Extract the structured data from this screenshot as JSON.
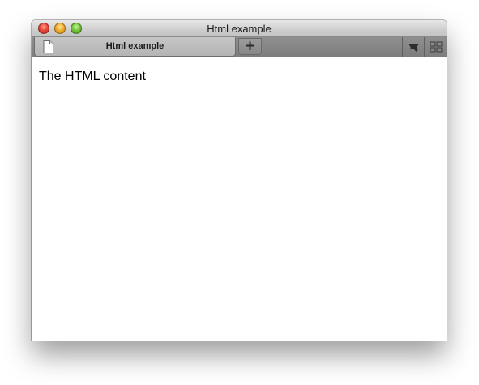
{
  "window": {
    "title": "Html example"
  },
  "tabs": [
    {
      "label": "Html example",
      "active": true
    }
  ],
  "new_tab_label": "+",
  "content": {
    "text": "The HTML content"
  }
}
